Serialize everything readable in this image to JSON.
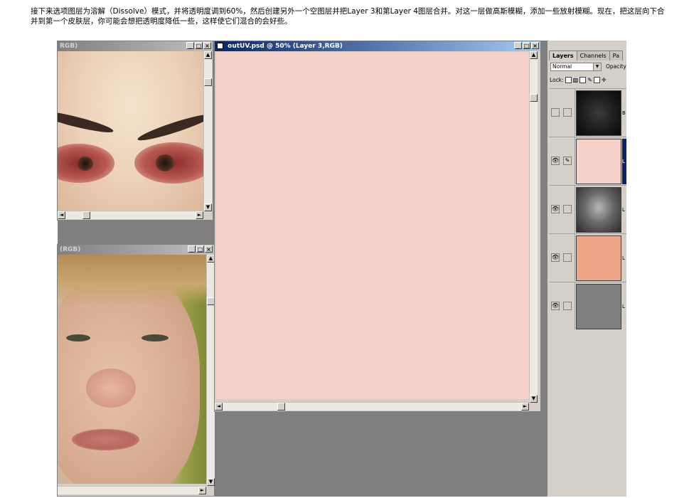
{
  "intro_text": "接下来选项图层为溶解（Dissolve）模式，并将透明度调到60%，然后创建另外一个空图层并把Layer 3和第Layer 4图层合并。对这一层做高斯模糊，添加一些放射模糊。现在，把这层向下合并到第一个皮肤层，你可能会想把透明度降低一些，这样使它们混合的会好些。",
  "doc_eyes": {
    "title": "RGB)"
  },
  "doc_boy": {
    "title": "(RGB)"
  },
  "doc_main": {
    "title": "outUV.psd @ 50% (Layer 3,RGB)",
    "canvas_color": "#f5d1c9"
  },
  "window_buttons": {
    "minimize": "_",
    "maximize": "□",
    "close": "×"
  },
  "layers_panel": {
    "tabs": [
      "Layers",
      "Channels",
      "Pa"
    ],
    "blend_mode": "Normal",
    "opacity_label": "Opacity",
    "lock_label": "Lock:",
    "layers": [
      {
        "label": "B",
        "thumb": "dark-face",
        "visible": false,
        "selected": false
      },
      {
        "label": "L",
        "thumb": "#f5d1c9",
        "visible": true,
        "selected": true
      },
      {
        "label": "L",
        "thumb": "gray-face",
        "visible": true,
        "selected": false
      },
      {
        "label": "L",
        "thumb": "#eea58a",
        "visible": true,
        "selected": false
      },
      {
        "label": "L",
        "thumb": "#7f7f7f",
        "visible": true,
        "selected": false
      }
    ]
  }
}
